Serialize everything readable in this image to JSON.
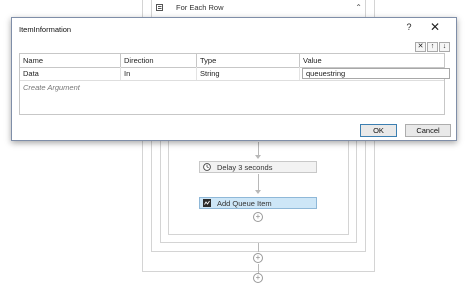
{
  "designer": {
    "foreach_title": "For Each Row",
    "activities": [
      {
        "label": "Delay 3 seconds",
        "icon": "clock-icon"
      },
      {
        "label": "Add Queue Item",
        "icon": "queue-icon"
      }
    ]
  },
  "dialog": {
    "title": "ItemInformation",
    "help_label": "?",
    "close_label": "✕",
    "tools": [
      "✕",
      "↑",
      "↓"
    ],
    "columns": [
      "Name",
      "Direction",
      "Type",
      "Value"
    ],
    "rows": [
      {
        "name": "Data",
        "direction": "In",
        "type": "String",
        "value": "queuestring"
      }
    ],
    "create_argument": "Create Argument",
    "ok_label": "OK",
    "cancel_label": "Cancel"
  },
  "colors": {
    "selected_activity": "#cde6f7",
    "dialog_border": "#7f8ea8",
    "ok_border": "#3c7fb1"
  }
}
